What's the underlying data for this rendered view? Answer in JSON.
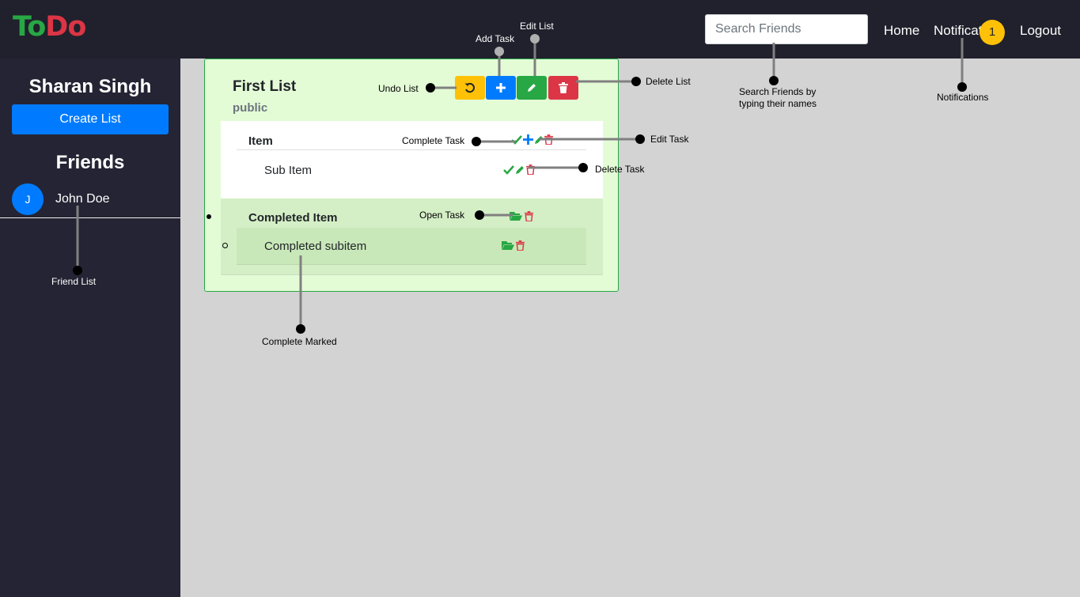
{
  "navbar": {
    "brand_to": "To",
    "brand_do": "Do",
    "search_placeholder": "Search Friends",
    "home": "Home",
    "notifications": "Notifications",
    "notification_count": "1",
    "logout": "Logout"
  },
  "sidebar": {
    "user_name": "Sharan Singh",
    "create_list": "Create List",
    "friends_title": "Friends",
    "friends": [
      {
        "initial": "J",
        "name": "John Doe"
      }
    ]
  },
  "list": {
    "title": "First List",
    "visibility": "public",
    "open_tasks": [
      {
        "title": "Item",
        "subitems": [
          "Sub Item"
        ]
      }
    ],
    "completed_tasks": [
      {
        "title": "Completed Item",
        "subitems": [
          "Completed subitem"
        ]
      }
    ]
  },
  "annotations": {
    "add_task": "Add Task",
    "edit_list": "Edit List",
    "undo_list": "Undo List",
    "delete_list": "Delete List",
    "complete_task": "Complete Task",
    "edit_task": "Edit Task",
    "delete_task": "Delete Task",
    "open_task": "Open Task",
    "complete_marked": "Complete Marked",
    "friend_list": "Friend List",
    "search_friends_line1": "Search Friends by",
    "search_friends_line2": "typing their names",
    "notifications": "Notifications"
  },
  "colors": {
    "navbar_bg": "#20212c",
    "sidebar_bg": "#252434",
    "primary": "#007bff",
    "success": "#28a745",
    "danger": "#dc3545",
    "warning": "#ffc107"
  }
}
